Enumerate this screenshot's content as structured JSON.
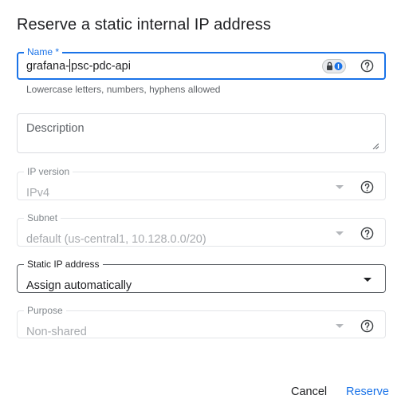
{
  "dialog": {
    "title": "Reserve a static internal IP address"
  },
  "name_field": {
    "label": "Name *",
    "value_before_caret": "grafana-",
    "value_after_caret": "psc-pdc-api",
    "hint": "Lowercase letters, numbers, hyphens allowed",
    "password_manager_icon": "password-manager-icon",
    "help_icon": "help-icon"
  },
  "description_field": {
    "label": "Description",
    "value": ""
  },
  "ip_version_field": {
    "label": "IP version",
    "value": "IPv4",
    "disabled": true
  },
  "subnet_field": {
    "label": "Subnet",
    "value": "default (us-central1, 10.128.0.0/20)",
    "disabled": true
  },
  "static_ip_field": {
    "label": "Static IP address",
    "value": "Assign automatically",
    "disabled": false
  },
  "purpose_field": {
    "label": "Purpose",
    "value": "Non-shared",
    "disabled": true
  },
  "actions": {
    "cancel_label": "Cancel",
    "reserve_label": "Reserve"
  },
  "colors": {
    "accent": "#1a73e8",
    "text": "#202124",
    "disabled_text": "#a8abaf",
    "border": "#dadce0"
  }
}
